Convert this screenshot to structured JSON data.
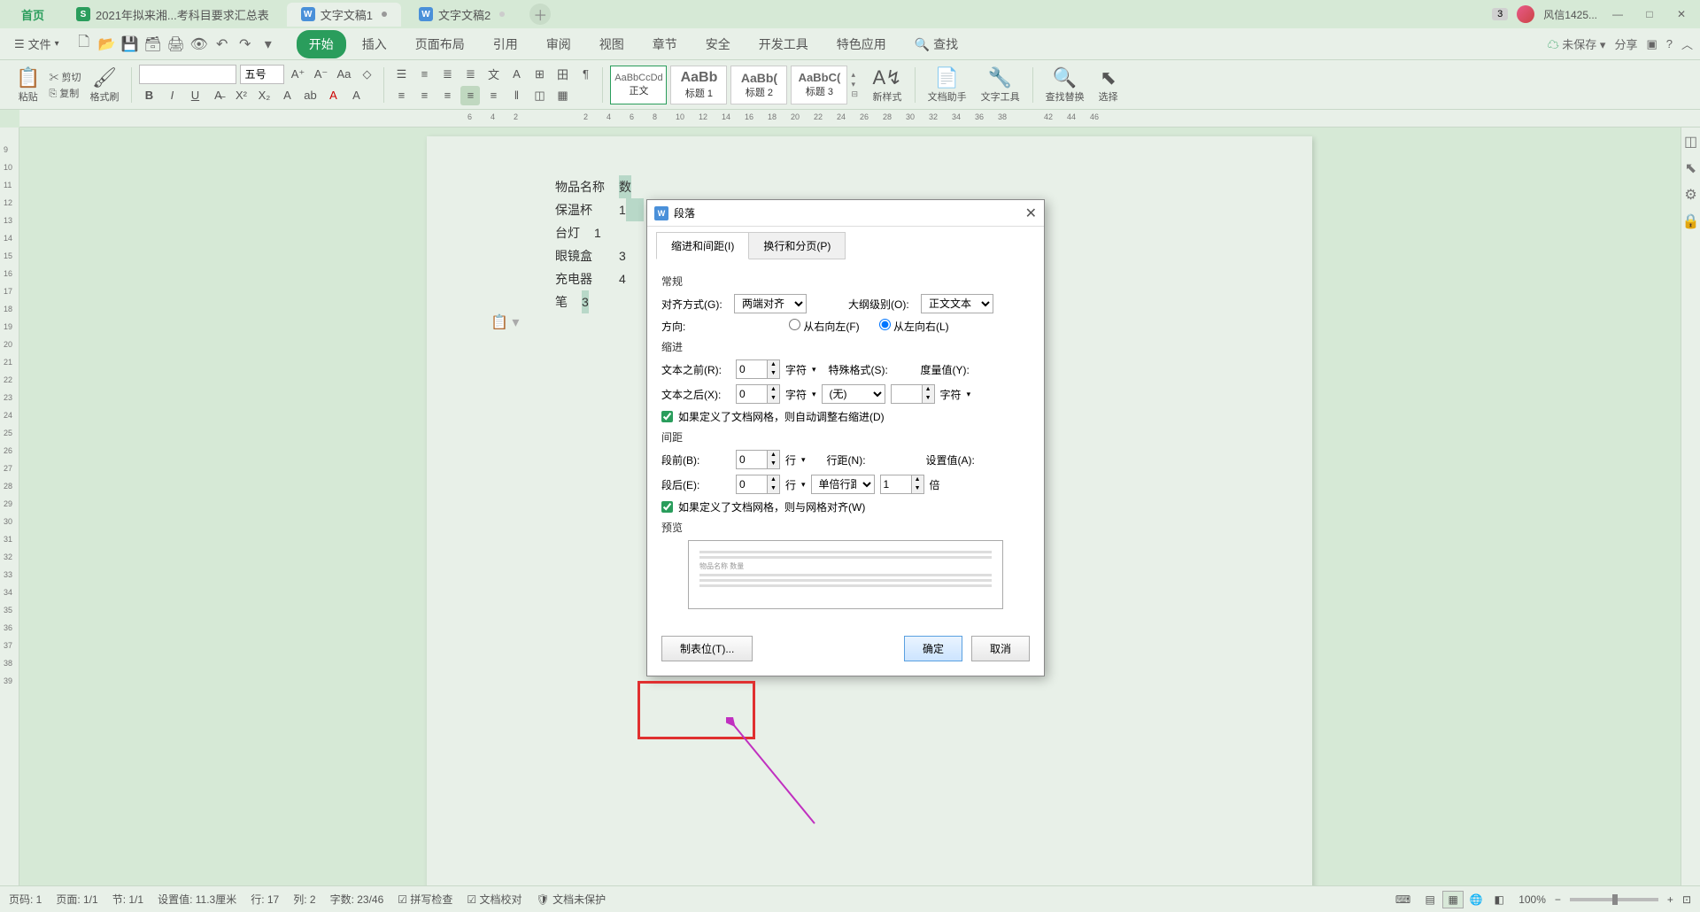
{
  "tabs": {
    "home": "首页",
    "t1": "2021年拟来湘...考科目要求汇总表",
    "t2": "文字文稿1",
    "t3": "文字文稿2"
  },
  "titlebar": {
    "badge": "3",
    "user": "风信1425..."
  },
  "menubar": {
    "file": "文件",
    "items": [
      "开始",
      "插入",
      "页面布局",
      "引用",
      "审阅",
      "视图",
      "章节",
      "安全",
      "开发工具",
      "特色应用"
    ],
    "search": "查找",
    "unsaved": "未保存",
    "share": "分享"
  },
  "ribbon": {
    "paste": "粘贴",
    "cut": "剪切",
    "copy": "复制",
    "format_painter": "格式刷",
    "font_size": "五号",
    "styles": [
      {
        "preview": "AaBbCcDd",
        "label": "正文"
      },
      {
        "preview": "AaBb",
        "label": "标题 1"
      },
      {
        "preview": "AaBb(",
        "label": "标题 2"
      },
      {
        "preview": "AaBbC(",
        "label": "标题 3"
      }
    ],
    "new_style": "新样式",
    "doc_assist": "文档助手",
    "text_tools": "文字工具",
    "find_replace": "查找替换",
    "select": "选择"
  },
  "document": {
    "rows": [
      {
        "name": "物品名称",
        "qty": "数"
      },
      {
        "name": "保温杯",
        "qty": "1"
      },
      {
        "name": "台灯",
        "qty": "1"
      },
      {
        "name": "眼镜盒",
        "qty": "3"
      },
      {
        "name": "充电器",
        "qty": "4"
      },
      {
        "name": "笔",
        "qty": "3"
      }
    ]
  },
  "dialog": {
    "title": "段落",
    "tab1": "缩进和间距(I)",
    "tab2": "换行和分页(P)",
    "sec_general": "常规",
    "align_label": "对齐方式(G):",
    "align_value": "两端对齐",
    "outline_label": "大纲级别(O):",
    "outline_value": "正文文本",
    "direction_label": "方向:",
    "rtl": "从右向左(F)",
    "ltr": "从左向右(L)",
    "sec_indent": "缩进",
    "before_text": "文本之前(R):",
    "after_text": "文本之后(X):",
    "unit_char": "字符",
    "special_label": "特殊格式(S):",
    "special_value": "(无)",
    "measure_label": "度量值(Y):",
    "chk_grid1": "如果定义了文档网格，则自动调整右缩进(D)",
    "sec_spacing": "间距",
    "before_para": "段前(B):",
    "after_para": "段后(E):",
    "unit_line": "行",
    "line_spacing": "行距(N):",
    "line_spacing_value": "单倍行距",
    "set_value": "设置值(A):",
    "set_value_num": "1",
    "unit_times": "倍",
    "chk_grid2": "如果定义了文档网格，则与网格对齐(W)",
    "sec_preview": "预览",
    "preview_sample": "物品名称 数量",
    "tab_stops": "制表位(T)...",
    "ok": "确定",
    "cancel": "取消",
    "zero": "0"
  },
  "statusbar": {
    "page_no": "页码: 1",
    "page": "页面: 1/1",
    "section": "节: 1/1",
    "setting": "设置值: 11.3厘米",
    "line": "行: 17",
    "col": "列: 2",
    "words": "字数: 23/46",
    "spell": "拼写检查",
    "proof": "文档校对",
    "protect": "文档未保护",
    "zoom": "100%"
  }
}
